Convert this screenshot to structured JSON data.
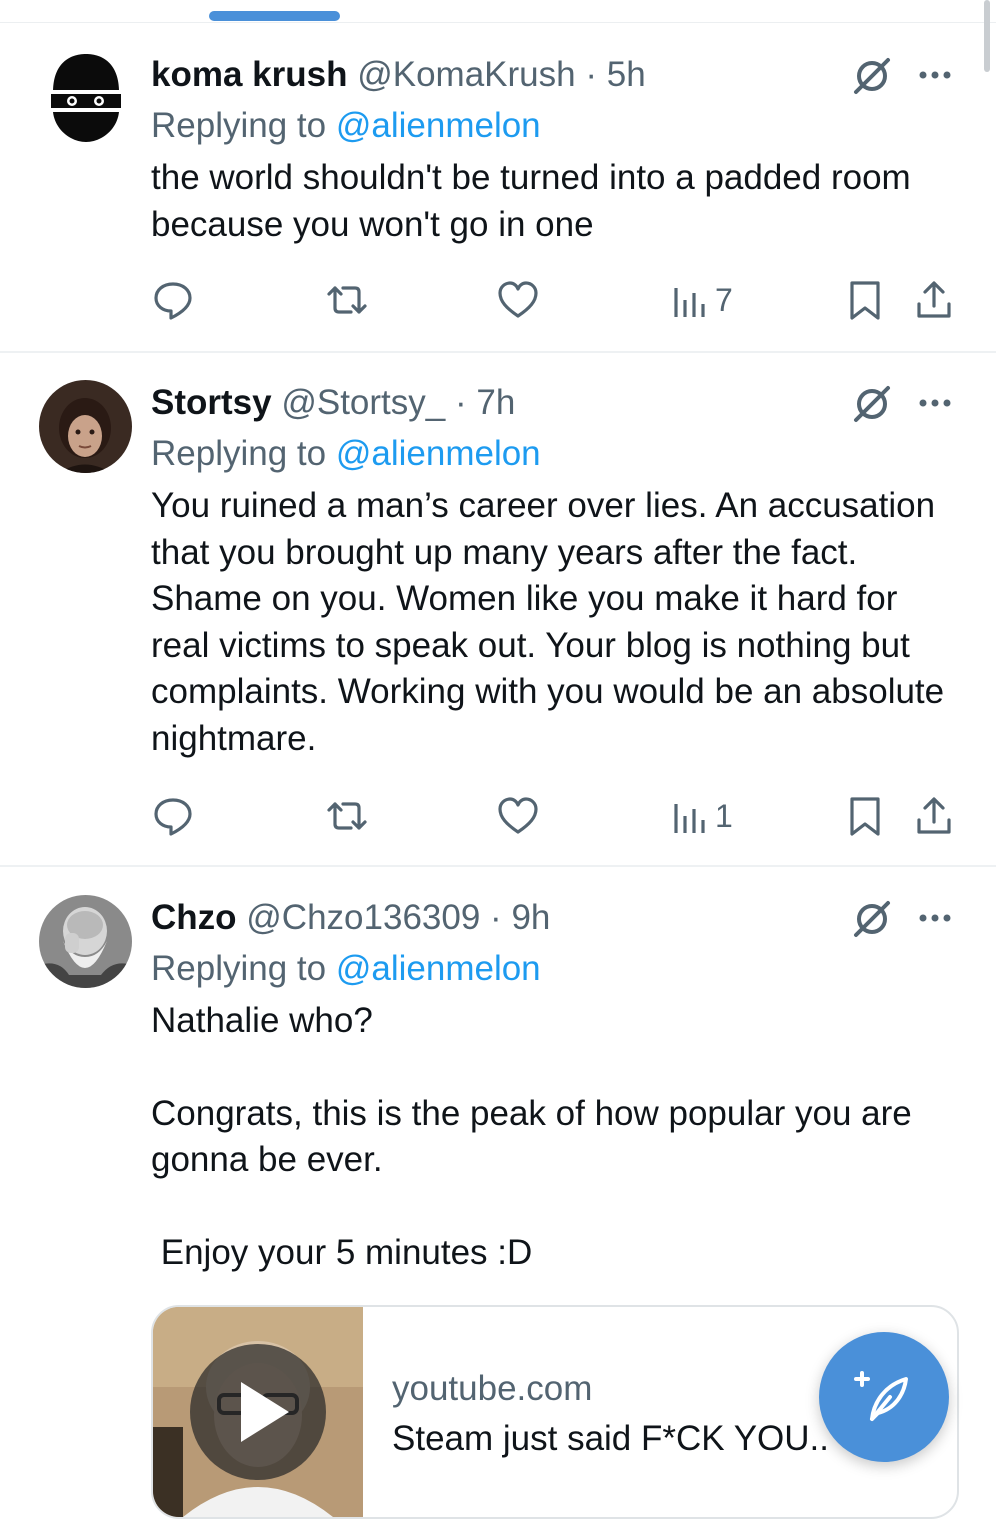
{
  "colors": {
    "accent": "#1d9bf0",
    "secondary_text": "#536471",
    "primary_text": "#0f1419",
    "fab": "#4a90d9"
  },
  "tweets": [
    {
      "name": "koma krush",
      "handle": "@KomaKrush",
      "separator": "·",
      "time": "5h",
      "replying_prefix": "Replying to",
      "replying_to": "@alienmelon",
      "body": [
        "the world shouldn't be turned into a padded room because you won't go in one"
      ],
      "views": "7",
      "avatar_icon": "masked-ninja-avatar"
    },
    {
      "name": "Stortsy",
      "handle": "@Stortsy_",
      "separator": "·",
      "time": "7h",
      "replying_prefix": "Replying to",
      "replying_to": "@alienmelon",
      "body": [
        "You ruined a man’s career over lies. An accusation that you brought up many years after the fact. Shame on you. Women like you make it hard for real victims to speak out. Your blog is nothing but complaints. Working with you would be an absolute nightmare."
      ],
      "views": "1",
      "avatar_icon": "portrait-avatar"
    },
    {
      "name": "Chzo",
      "handle": "@Chzo136309",
      "separator": "·",
      "time": "9h",
      "replying_prefix": "Replying to",
      "replying_to": "@alienmelon",
      "body": [
        "Nathalie who?",
        "Congrats, this is the peak of how popular you are gonna be ever.",
        " Enjoy your 5 minutes :D"
      ],
      "avatar_icon": "bearded-man-avatar"
    }
  ],
  "card": {
    "domain": "youtube.com",
    "title": "Steam just said F*CK YOU..",
    "thumb_icon": "video-play-icon"
  },
  "fab_icon": "compose-post-icon"
}
